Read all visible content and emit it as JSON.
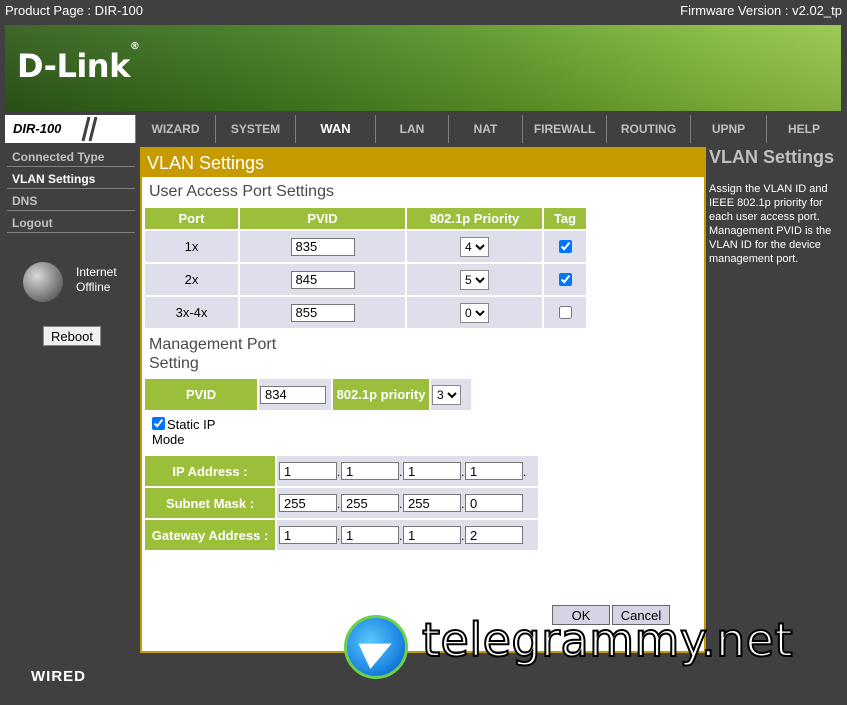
{
  "header": {
    "product_page": "Product Page : DIR-100",
    "firmware_version": "Firmware Version : v2.02_tp"
  },
  "brand": {
    "logo_text": "D-Link",
    "logo_mark": "®",
    "model": "DIR-100"
  },
  "nav": {
    "tabs": [
      {
        "label": "WIZARD"
      },
      {
        "label": "SYSTEM"
      },
      {
        "label": "WAN",
        "active": true
      },
      {
        "label": "LAN"
      },
      {
        "label": "NAT"
      },
      {
        "label": "FIREWALL"
      },
      {
        "label": "ROUTING"
      },
      {
        "label": "UPNP"
      },
      {
        "label": "HELP"
      }
    ]
  },
  "sidebar": {
    "items": [
      {
        "label": "Connected Type"
      },
      {
        "label": "VLAN Settings",
        "active": true
      },
      {
        "label": "DNS"
      },
      {
        "label": "Logout"
      }
    ],
    "status_line1": "Internet",
    "status_line2": "Offline",
    "reboot_label": "Reboot"
  },
  "main": {
    "title": "VLAN Settings",
    "user_access_title": "User Access Port Settings",
    "columns": [
      "Port",
      "PVID",
      "802.1p Priority",
      "Tag"
    ],
    "rows": [
      {
        "port": "1x",
        "pvid": "835",
        "priority": "4",
        "tag": true
      },
      {
        "port": "2x",
        "pvid": "845",
        "priority": "5",
        "tag": true
      },
      {
        "port": "3x-4x",
        "pvid": "855",
        "priority": "0",
        "tag": false
      }
    ],
    "management_title_line1": "Management Port",
    "management_title_line2": "Setting",
    "mgmt_pvid_label": "PVID",
    "mgmt_pvid_value": "834",
    "mgmt_priority_label": "802.1p priority",
    "mgmt_priority_value": "3",
    "static_ip_line1": "Static IP",
    "static_ip_line2": "Mode",
    "static_ip_checked": true,
    "ip_label": "IP Address :",
    "ip": [
      "1",
      "1",
      "1",
      "1"
    ],
    "mask_label": "Subnet Mask :",
    "mask": [
      "255",
      "255",
      "255",
      "0"
    ],
    "gateway_label": "Gateway Address :",
    "gateway": [
      "1",
      "1",
      "1",
      "2"
    ],
    "ok_label": "OK",
    "cancel_label": "Cancel"
  },
  "help": {
    "title": "VLAN Settings",
    "text": "Assign the VLAN ID and IEEE 802.1p priority for each user access port. Management PVID is the VLAN ID for the device management port."
  },
  "footer": {
    "label": "WIRED"
  },
  "watermark": {
    "text": "telegrammy.net"
  },
  "colors": {
    "accent": "#c79b00",
    "green": "#9bbf3b",
    "dark": "#404040",
    "cell": "#dfdfec"
  }
}
